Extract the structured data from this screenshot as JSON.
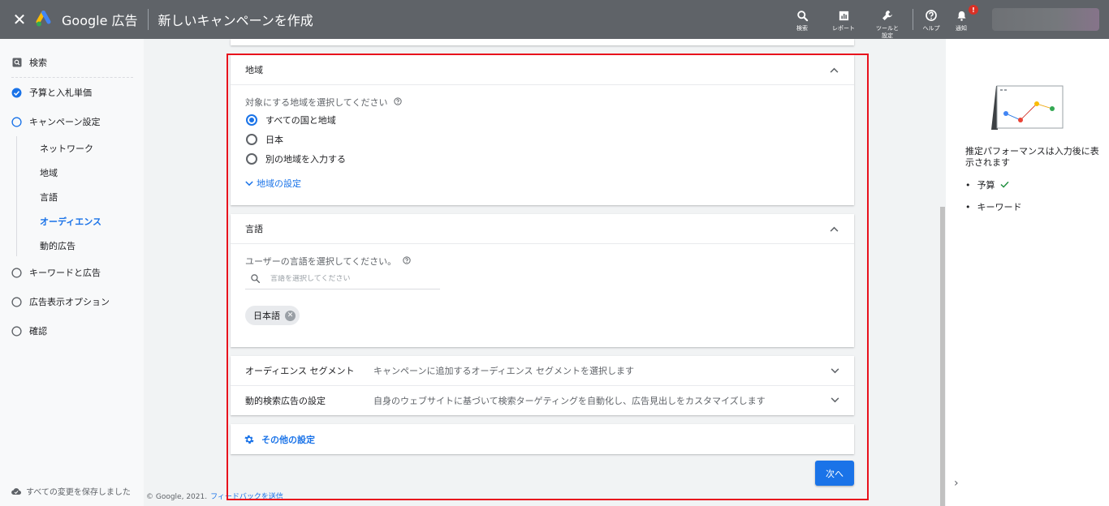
{
  "header": {
    "close_label": "✕",
    "brand": "Google 広告",
    "title": "新しいキャンペーンを作成",
    "tools": [
      {
        "label": "検索",
        "icon": "search-icon"
      },
      {
        "label": "レポート",
        "icon": "report-icon"
      },
      {
        "label": "ツールと\n設定",
        "icon": "wrench-icon"
      },
      {
        "label": "ヘルプ",
        "icon": "help-icon"
      },
      {
        "label": "通知",
        "icon": "bell-icon",
        "badge": "!"
      }
    ]
  },
  "sidebar": {
    "items": [
      {
        "label": "検索",
        "state": "search"
      },
      {
        "label": "予算と入札単価",
        "state": "done"
      },
      {
        "label": "キャンペーン設定",
        "state": "current"
      },
      {
        "label": "キーワードと広告",
        "state": "todo"
      },
      {
        "label": "広告表示オプション",
        "state": "todo"
      },
      {
        "label": "確認",
        "state": "todo"
      }
    ],
    "subitems": [
      {
        "label": "ネットワーク",
        "active": false
      },
      {
        "label": "地域",
        "active": false
      },
      {
        "label": "言語",
        "active": false
      },
      {
        "label": "オーディエンス",
        "active": true
      },
      {
        "label": "動的広告",
        "active": false
      }
    ],
    "saved": "すべての変更を保存しました"
  },
  "location": {
    "title": "地域",
    "prompt": "対象にする地域を選択してください",
    "options": [
      {
        "label": "すべての国と地域",
        "selected": true
      },
      {
        "label": "日本",
        "selected": false
      },
      {
        "label": "別の地域を入力する",
        "selected": false
      }
    ],
    "settings_link": "地域の設定"
  },
  "language": {
    "title": "言語",
    "prompt": "ユーザーの言語を選択してください。",
    "search_placeholder": "言語を選択してください",
    "chip": "日本語"
  },
  "rows": [
    {
      "title": "オーディエンス セグメント",
      "desc": "キャンペーンに追加するオーディエンス セグメントを選択します"
    },
    {
      "title": "動的検索広告の設定",
      "desc": "自身のウェブサイトに基づいて検索ターゲティングを自動化し、広告見出しをカスタマイズします"
    }
  ],
  "other_settings": "その他の設定",
  "next_button": "次へ",
  "footer": {
    "copyright": "© Google, 2021.",
    "feedback": "フィードバックを送信"
  },
  "right_panel": {
    "text": "推定パフォーマンスは入力後に表示されます",
    "list": [
      {
        "label": "予算",
        "checked": true
      },
      {
        "label": "キーワード",
        "checked": false
      }
    ],
    "arrow": "›"
  },
  "colors": {
    "header": "#5f6368",
    "accent": "#1a73e8",
    "highlight": "#e8111c"
  }
}
